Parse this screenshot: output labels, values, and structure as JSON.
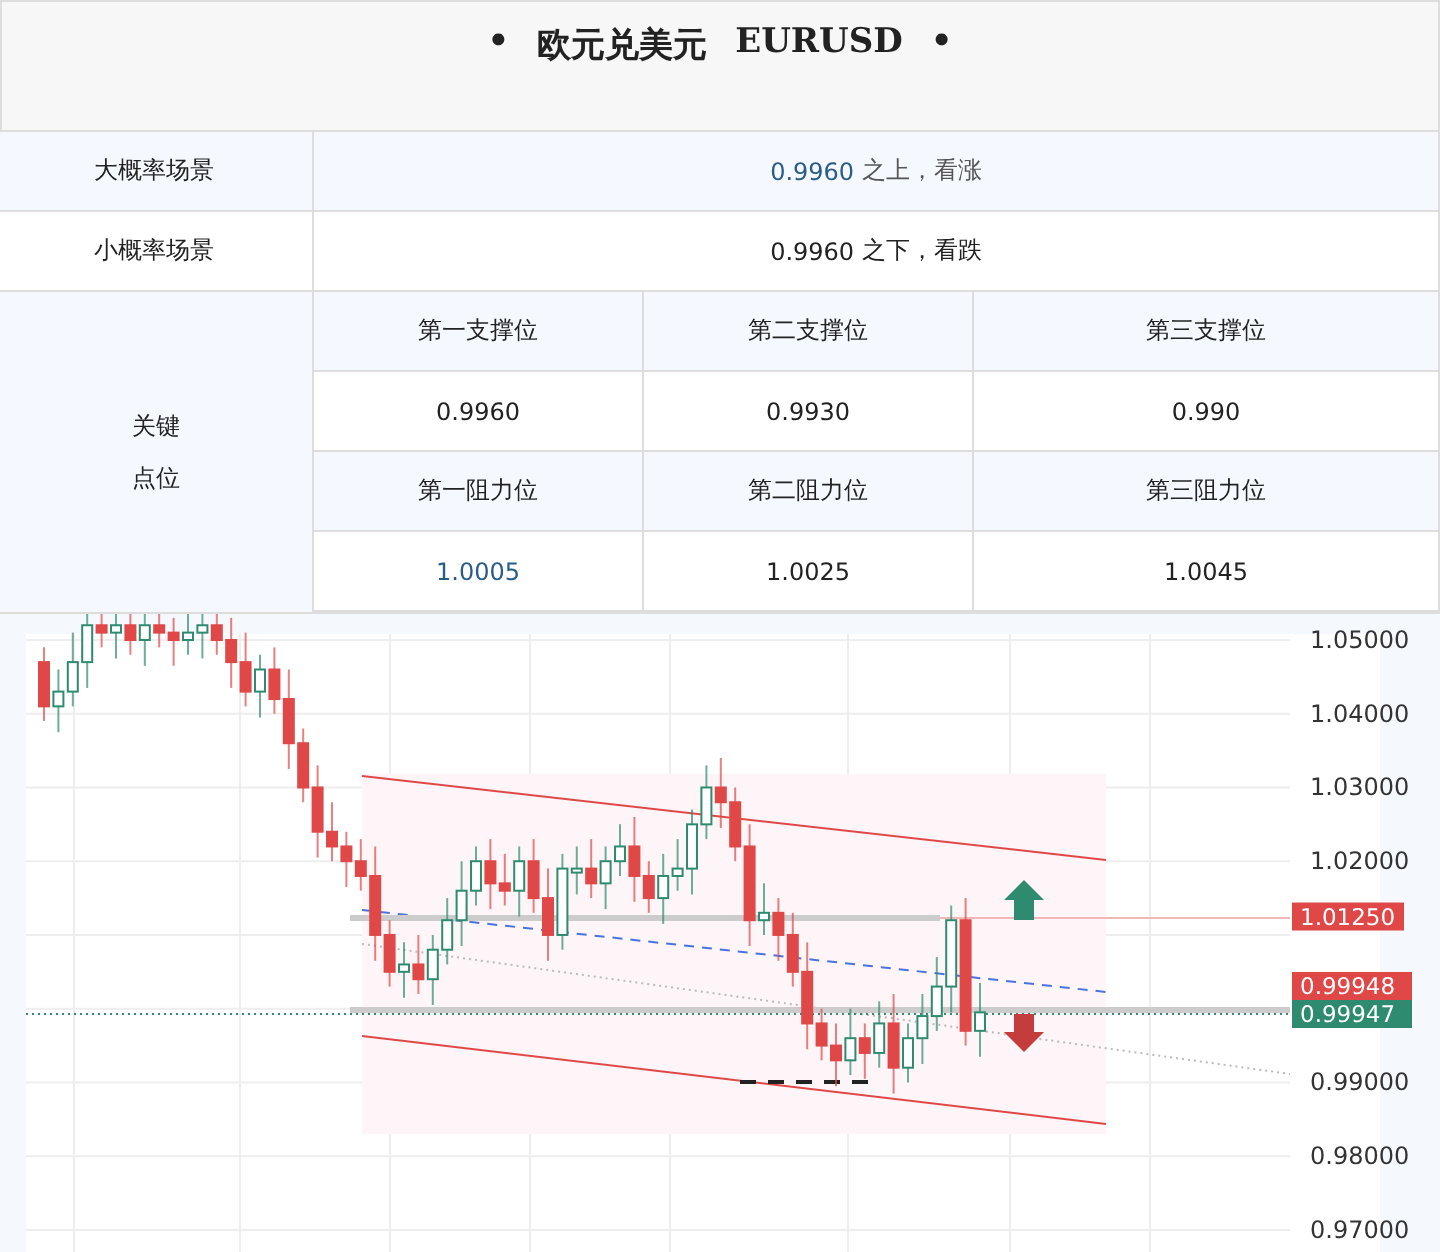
{
  "title": {
    "bullets": [
      "•",
      "•"
    ],
    "name": "欧元兑美元",
    "symbol": "EURUSD"
  },
  "scenarios": [
    {
      "label": "大概率场景",
      "price": "0.9960",
      "note": "之上，看涨",
      "highlighted": true
    },
    {
      "label": "小概率场景",
      "price": "0.9960",
      "note": "之下，看跌",
      "highlighted": false
    }
  ],
  "key_levels": {
    "label": "关键点位",
    "rows": [
      {
        "kind": "header",
        "cells": [
          {
            "text": "第一支撑位",
            "highlighted": false
          },
          {
            "text": "第二支撑位",
            "highlighted": false
          },
          {
            "text": "第三支撑位",
            "highlighted": false
          }
        ]
      },
      {
        "kind": "value",
        "cells": [
          {
            "text": "0.9960",
            "highlighted": false
          },
          {
            "text": "0.9930",
            "highlighted": false
          },
          {
            "text": "0.990",
            "highlighted": false
          }
        ]
      },
      {
        "kind": "header",
        "cells": [
          {
            "text": "第一阻力位",
            "highlighted": false
          },
          {
            "text": "第二阻力位",
            "highlighted": false
          },
          {
            "text": "第三阻力位",
            "highlighted": false
          }
        ]
      },
      {
        "kind": "value",
        "cells": [
          {
            "text": "1.0005",
            "highlighted": true
          },
          {
            "text": "1.0025",
            "highlighted": false
          },
          {
            "text": "1.0045",
            "highlighted": false
          }
        ]
      }
    ]
  },
  "chart": {
    "axis_labels": [
      "1.05000",
      "1.04000",
      "1.03000",
      "1.02000",
      "0.99000",
      "0.98000",
      "0.97000"
    ],
    "price_tags": [
      {
        "text": "1.01250",
        "color": "#e04848"
      },
      {
        "text": "0.99948",
        "color": "#e04848"
      },
      {
        "text": "0.99947",
        "color": "#2e8b6f"
      }
    ]
  }
}
